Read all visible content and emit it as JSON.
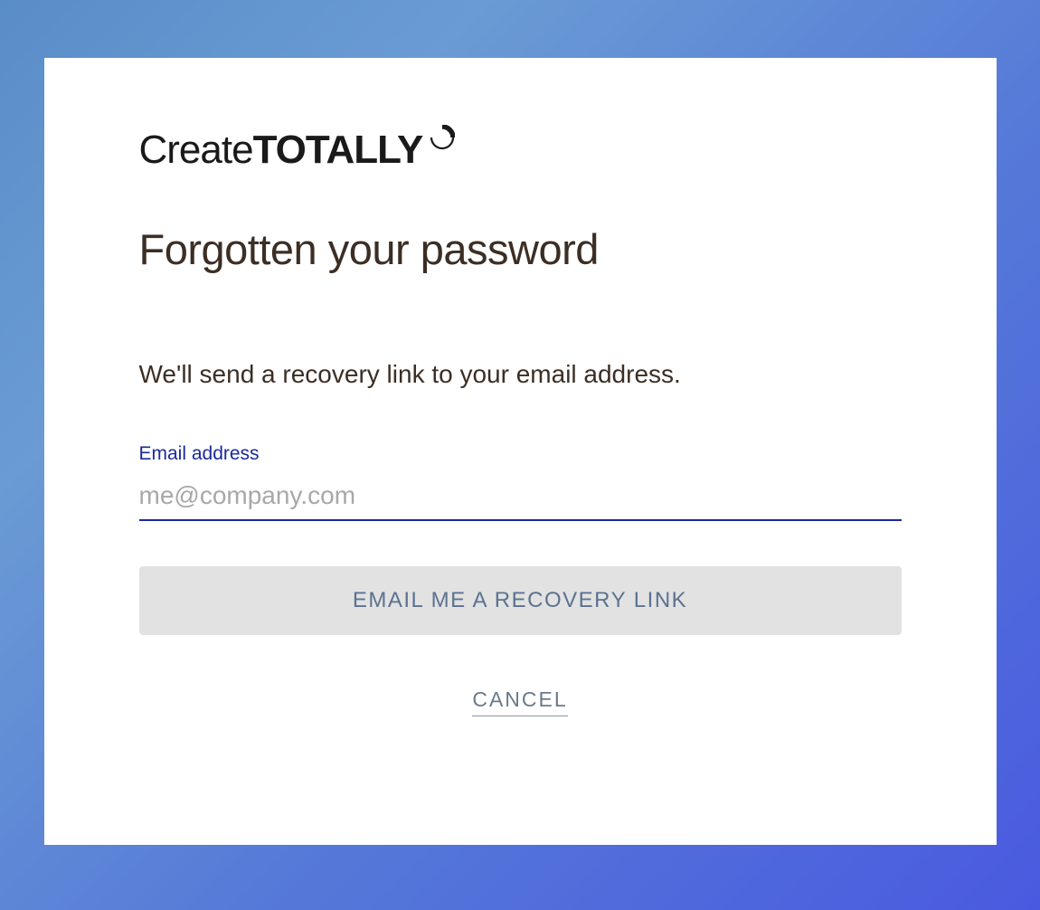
{
  "logo": {
    "part1": "Create",
    "part2": "TOTALLY"
  },
  "heading": "Forgotten your password",
  "description": "We'll send a recovery link to your email address.",
  "form": {
    "email_label": "Email address",
    "email_placeholder": "me@company.com",
    "email_value": "",
    "submit_label": "EMAIL ME A RECOVERY LINK",
    "cancel_label": "CANCEL"
  }
}
